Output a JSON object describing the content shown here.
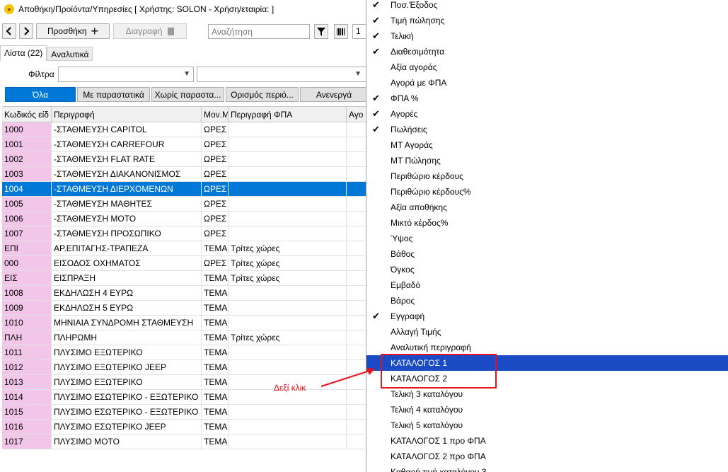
{
  "window": {
    "title": "Αποθήκη/Προϊόντα/Υπηρεσίες  [ Χρήστης: SOLON - Χρήση/εταιρία:      ]"
  },
  "toolbar": {
    "back_icon": "chevron-left-icon",
    "forward_icon": "chevron-right-icon",
    "add_label": "Προσθήκη",
    "delete_label": "Διαγραφή",
    "search_placeholder": "Αναζήτηση",
    "page_value": "1"
  },
  "tabs": [
    {
      "label": "Λίστα (22)"
    },
    {
      "label": "Αναλυτικά"
    }
  ],
  "filters": {
    "label": "Φίλτρα"
  },
  "categories": [
    {
      "label": "Όλα"
    },
    {
      "label": "Με παραστατικά"
    },
    {
      "label": "Χωρίς παραστα..."
    },
    {
      "label": "Ορισμός περιό..."
    },
    {
      "label": "Ανενεργά"
    }
  ],
  "grid": {
    "headers": [
      "Κωδικός είδ",
      "Περιγραφή",
      "Μον.Μ",
      "Περιγραφή ΦΠΑ",
      "Αγο"
    ],
    "selected_index": 4,
    "rows": [
      [
        "1000",
        "-ΣΤΑΘΜΕΥΣΗ CAPITOL",
        "ΩΡΕΣ",
        "",
        ""
      ],
      [
        "1001",
        "-ΣΤΑΘΜΕΥΣΗ CARREFOUR",
        "ΩΡΕΣ",
        "",
        ""
      ],
      [
        "1002",
        "-ΣΤΑΘΜΕΥΣΗ FLAT RATE",
        "ΩΡΕΣ",
        "",
        ""
      ],
      [
        "1003",
        "-ΣΤΑΘΜΕΥΣΗ ΔΙΑΚΑΝΟΝΙΣΜΟΣ",
        "ΩΡΕΣ",
        "",
        ""
      ],
      [
        "1004",
        "-ΣΤΑΘΜΕΥΣΗ ΔΙΕΡΧΟΜΕΝΩΝ",
        "ΩΡΕΣ",
        "",
        ""
      ],
      [
        "1005",
        "-ΣΤΑΘΜΕΥΣΗ ΜΑΘΗΤΕΣ",
        "ΩΡΕΣ",
        "",
        ""
      ],
      [
        "1006",
        "-ΣΤΑΘΜΕΥΣΗ ΜΟΤΟ",
        "ΩΡΕΣ",
        "",
        ""
      ],
      [
        "1007",
        "-ΣΤΑΘΜΕΥΣΗ ΠΡΟΣΩΠΙΚΟ",
        "ΩΡΕΣ",
        "",
        ""
      ],
      [
        "ΕΠΙ",
        "ΑΡ.ΕΠΙΤΑΓΗΣ-ΤΡΑΠΕΖΑ",
        "ΤΕΜΑ",
        "Τρίτες χώρες",
        ""
      ],
      [
        "000",
        "ΕΙΣΟΔΟΣ ΟΧΗΜΑΤΟΣ",
        "ΩΡΕΣ",
        "Τρίτες χώρες",
        ""
      ],
      [
        "ΕΙΣ",
        "ΕΙΣΠΡΑΞΗ",
        "ΤΕΜΑ",
        "Τρίτες χώρες",
        ""
      ],
      [
        "1008",
        "ΕΚΔΗΛΩΣΗ 4 ΕΥΡΩ",
        "ΤΕΜΑ",
        "",
        ""
      ],
      [
        "1009",
        "ΕΚΔΗΛΩΣΗ 5 ΕΥΡΩ",
        "ΤΕΜΑ",
        "",
        ""
      ],
      [
        "1010",
        "ΜΗΝΙΑΙΑ ΣΥΝΔΡΟΜΗ ΣΤΑΘΜΕΥΣΗ",
        "ΤΕΜΑ",
        "",
        ""
      ],
      [
        "ΠΛΗ",
        "ΠΛΗΡΩΜΗ",
        "ΤΕΜΑ",
        "Τρίτες χώρες",
        ""
      ],
      [
        "1011",
        "ΠΛΥΣΙΜΟ ΕΞΩΤΕΡΙΚΟ",
        "ΤΕΜΑ",
        "",
        ""
      ],
      [
        "1012",
        "ΠΛΥΣΙΜΟ ΕΞΩΤΕΡΙΚΟ JEEP",
        "ΤΕΜΑ",
        "",
        ""
      ],
      [
        "1013",
        "ΠΛΥΣΙΜΟ ΕΞΩΤΕΡΙΚΟ",
        "ΤΕΜΑ",
        "",
        ""
      ],
      [
        "1014",
        "ΠΛΥΣΙΜΟ ΕΣΩΤΕΡΙΚΟ - ΕΞΩΤΕΡΙΚΟ",
        "ΤΕΜΑ",
        "",
        ""
      ],
      [
        "1015",
        "ΠΛΥΣΙΜΟ ΕΣΩΤΕΡΙΚΟ - ΕΞΩΤΕΡΙΚΟ",
        "ΤΕΜΑ",
        "",
        ""
      ],
      [
        "1016",
        "ΠΛΥΣΙΜΟ ΕΣΩΤΕΡΙΚΟ JEEP",
        "ΤΕΜΑ",
        "",
        ""
      ],
      [
        "1017",
        "ΠΛΥΣΙΜΟ ΜΟΤΟ",
        "ΤΕΜΑ",
        "",
        ""
      ]
    ]
  },
  "context_menu": {
    "items": [
      {
        "label": "Ποσ.Έξοδος",
        "checked": true
      },
      {
        "label": "Τιμή πώλησης",
        "checked": true
      },
      {
        "label": "Τελική",
        "checked": true
      },
      {
        "label": "Διαθεσιμότητα",
        "checked": true
      },
      {
        "label": "Αξία αγοράς",
        "checked": false
      },
      {
        "label": "Αγορά με ΦΠΑ",
        "checked": false
      },
      {
        "label": "ΦΠΑ %",
        "checked": true
      },
      {
        "label": "Αγορές",
        "checked": true
      },
      {
        "label": "Πωλήσεις",
        "checked": true
      },
      {
        "label": "ΜΤ Αγοράς",
        "checked": false
      },
      {
        "label": "ΜΤ Πώλησης",
        "checked": false
      },
      {
        "label": "Περιθώριο κέρδους",
        "checked": false
      },
      {
        "label": "Περιθώριο κέρδους%",
        "checked": false
      },
      {
        "label": "Αξία αποθήκης",
        "checked": false
      },
      {
        "label": "Μικτό κέρδος%",
        "checked": false
      },
      {
        "label": "Ύψος",
        "checked": false
      },
      {
        "label": "Βάθος",
        "checked": false
      },
      {
        "label": "Όγκος",
        "checked": false
      },
      {
        "label": "Εμβαδό",
        "checked": false
      },
      {
        "label": "Βάρος",
        "checked": false
      },
      {
        "label": "Εγγραφή",
        "checked": true
      },
      {
        "label": "Αλλαγή Τιμής",
        "checked": false
      },
      {
        "label": "Αναλυτική περιγραφή",
        "checked": false
      },
      {
        "label": "ΚΑΤΑΛΟΓΟΣ 1",
        "checked": false,
        "highlighted": true
      },
      {
        "label": "ΚΑΤΑΛΟΓΟΣ 2",
        "checked": false
      },
      {
        "label": "Τελική 3 καταλόγου",
        "checked": false
      },
      {
        "label": "Τελική 4 καταλόγου",
        "checked": false
      },
      {
        "label": "Τελική 5 καταλόγου",
        "checked": false
      },
      {
        "label": "ΚΑΤΑΛΟΓΟΣ 1 προ ΦΠΑ",
        "checked": false
      },
      {
        "label": "ΚΑΤΑΛΟΓΟΣ 2 προ ΦΠΑ",
        "checked": false
      },
      {
        "label": "Καθαρή τιμή καταλόγου 3",
        "checked": false
      }
    ],
    "check_glyph": "✔"
  },
  "annotation": {
    "text": "Δεξί κλικ",
    "color": "#e8101a"
  },
  "colors": {
    "accent": "#0078d7",
    "menu_highlight": "#1a4bc4",
    "code_cell": "#f2c6e8"
  }
}
